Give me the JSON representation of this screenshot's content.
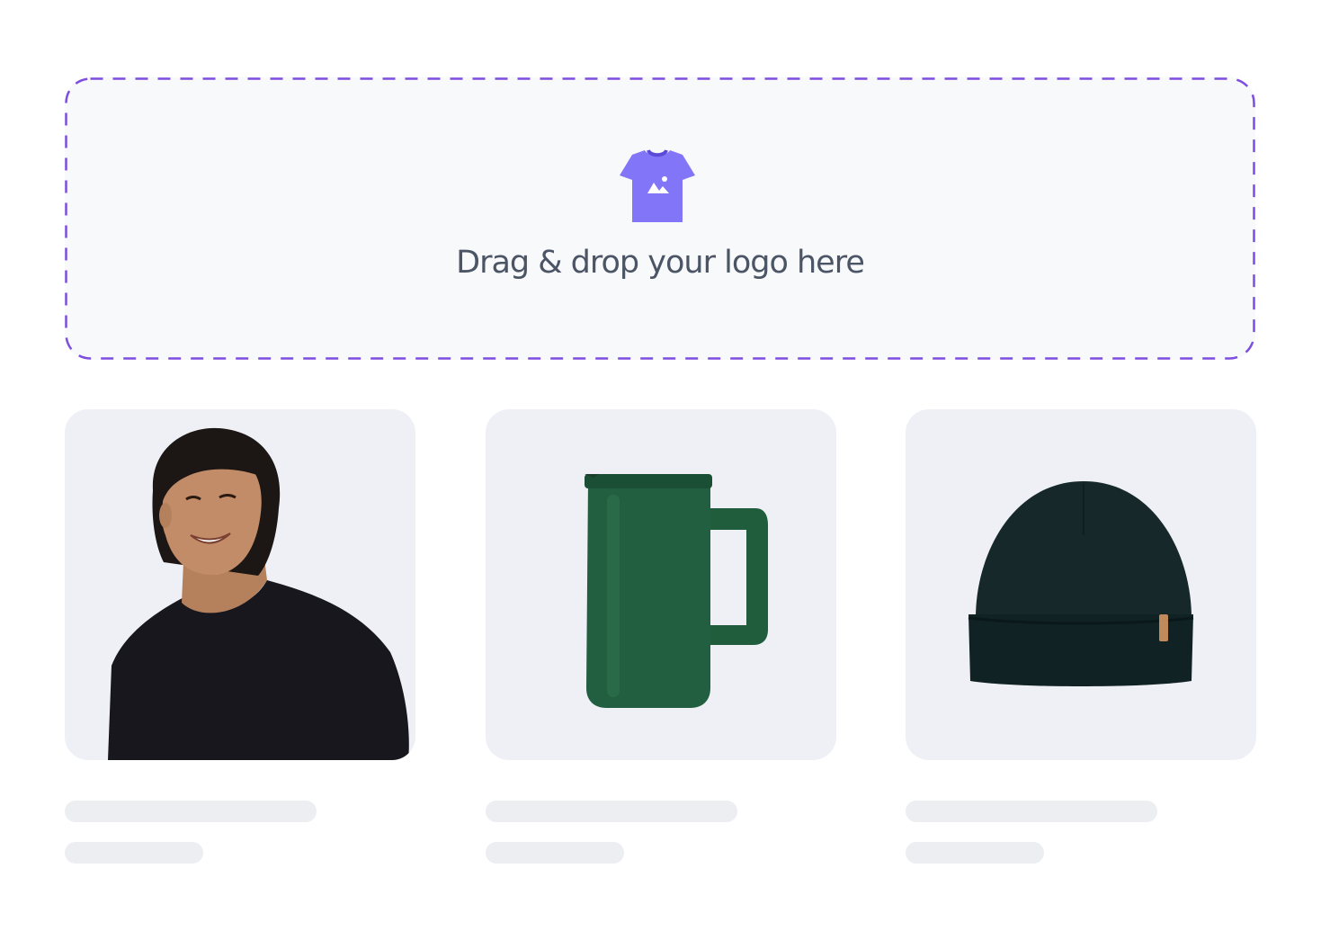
{
  "dropzone": {
    "text": "Drag & drop your logo here",
    "icon": "tshirt-image-icon",
    "border_color": "#7e4ee0",
    "icon_color": "#8275f8"
  },
  "products": [
    {
      "name": "t-shirt",
      "image": "man-in-black-tshirt"
    },
    {
      "name": "mug",
      "image": "green-travel-mug"
    },
    {
      "name": "beanie",
      "image": "dark-green-beanie"
    }
  ],
  "colors": {
    "card_bg": "#eef0f6",
    "skeleton": "#eceef1"
  }
}
